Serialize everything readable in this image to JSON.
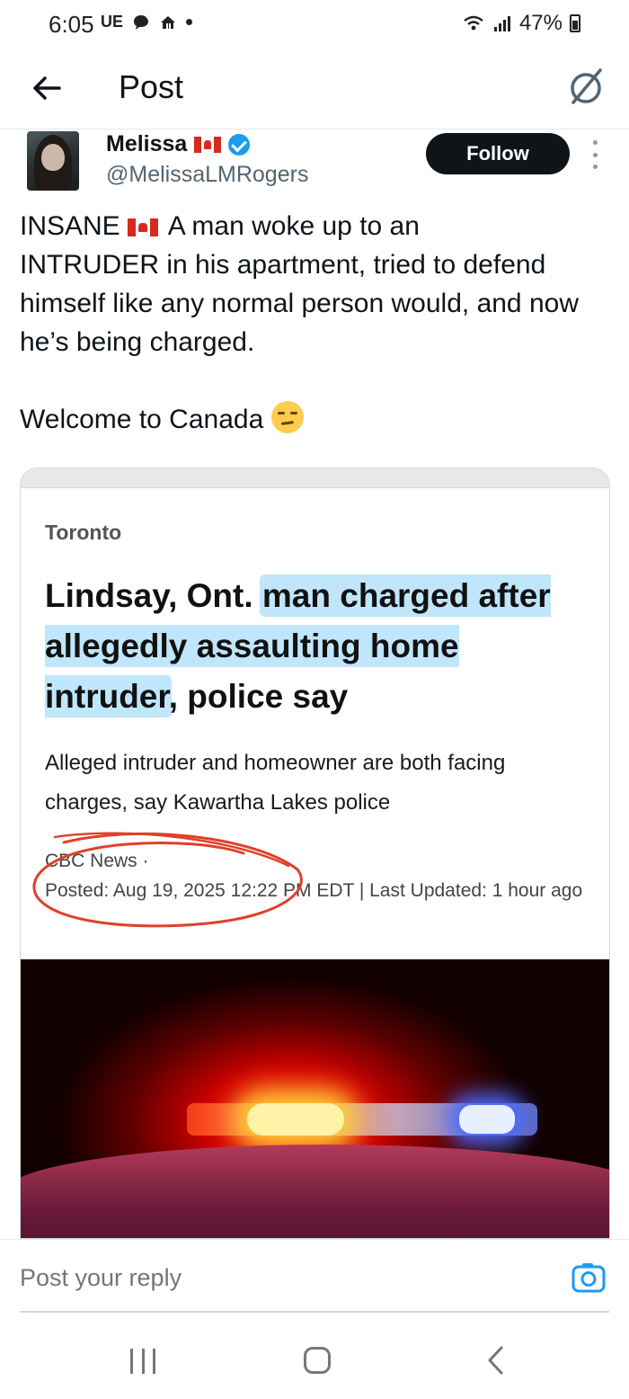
{
  "status_bar": {
    "time": "6:05",
    "carrier": "UE",
    "battery": "47%"
  },
  "header": {
    "title": "Post"
  },
  "author": {
    "name": "Melissa",
    "handle": "@MelissaLMRogers",
    "follow_label": "Follow"
  },
  "tweet": {
    "line1_rest": "A man woke up to an",
    "line1_lead": "INSANE",
    "body": "INTRUDER in his apartment, tried to defend himself like any normal person would, and now he’s being charged.",
    "closing": "Welcome to Canada"
  },
  "article": {
    "section": "Toronto",
    "headline_plain_start": "Lindsay, Ont. ",
    "headline_highlight": "man charged after allegedly assaulting home intruder",
    "headline_plain_end": ", police say",
    "dek": "Alleged intruder and homeowner are both facing charges, say Kawartha Lakes police",
    "source": "CBC News ·",
    "dateline": "Posted: Aug 19, 2025 12:22 PM EDT | Last Updated: 1 hour ago"
  },
  "reply": {
    "placeholder": "Post your reply"
  },
  "icons": {
    "back": "arrow-left-icon",
    "grok": "grok-icon",
    "verified": "verified-badge-icon",
    "more": "more-vertical-icon",
    "camera": "camera-icon"
  },
  "colors": {
    "accent": "#1d9bf0",
    "follow_bg": "#0f1419",
    "highlight": "#bfe6fb",
    "annotation_circle": "#e0402a"
  }
}
